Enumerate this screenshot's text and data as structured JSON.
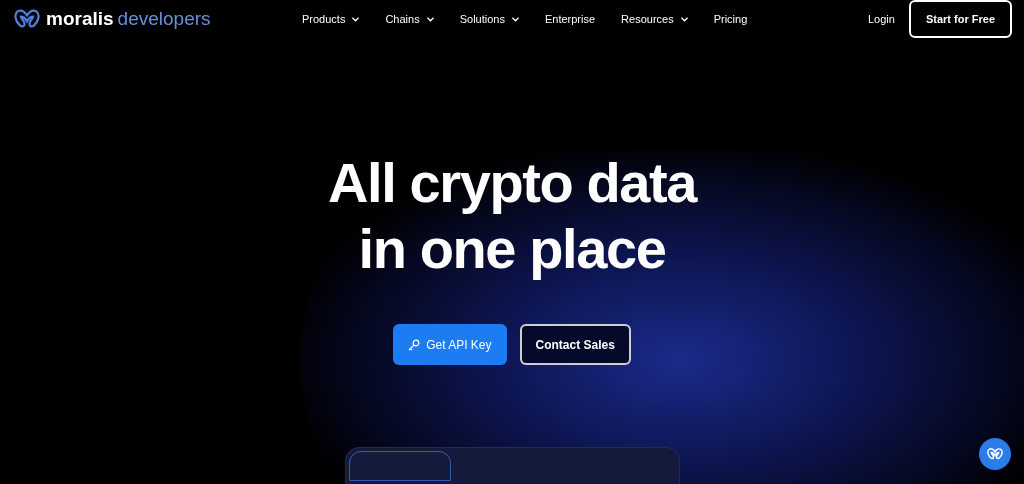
{
  "header": {
    "logo": {
      "brand": "moralis",
      "suffix": "developers"
    },
    "nav": [
      {
        "label": "Products",
        "dropdown": true
      },
      {
        "label": "Chains",
        "dropdown": true
      },
      {
        "label": "Solutions",
        "dropdown": true
      },
      {
        "label": "Enterprise",
        "dropdown": false
      },
      {
        "label": "Resources",
        "dropdown": true
      },
      {
        "label": "Pricing",
        "dropdown": false
      }
    ],
    "login": "Login",
    "cta": "Start for Free"
  },
  "hero": {
    "title_lines": [
      "All crypto data",
      "in one place"
    ],
    "buttons": [
      {
        "label": "Get API Key",
        "kind": "primary"
      },
      {
        "label": "Contact Sales",
        "kind": "outline"
      }
    ]
  }
}
